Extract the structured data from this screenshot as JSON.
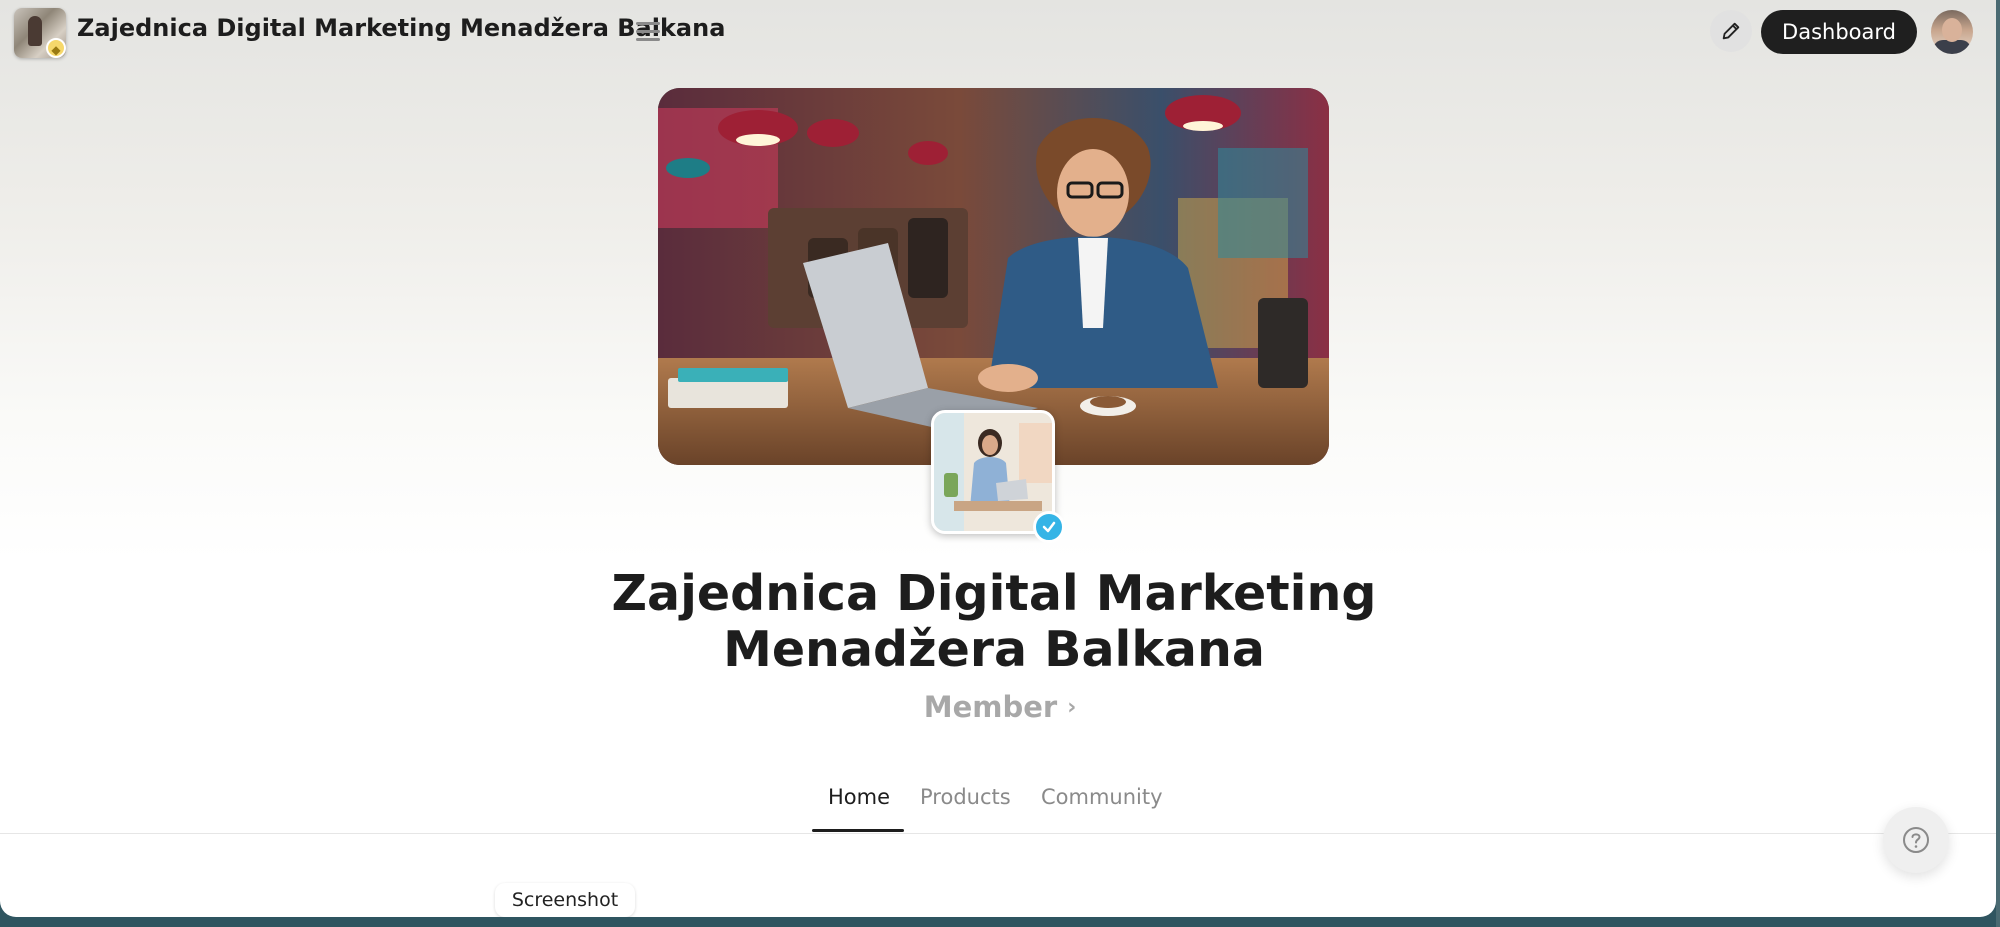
{
  "header": {
    "site_title": "Zajednica Digital Marketing Menadžera Balkana",
    "dashboard_label": "Dashboard",
    "logo_icon": "community-logo",
    "menu_icon": "hamburger-icon",
    "edit_icon": "pencil-icon",
    "avatar_icon": "user-avatar"
  },
  "hero": {
    "cover_image": "cover-photo-man-laptop-cafe",
    "profile_image": "community-photo-woman-laptop",
    "verified_icon": "check-icon",
    "title": "Zajednica Digital Marketing Menadžera Balkana",
    "membership_label": "Member",
    "membership_chevron": "›"
  },
  "tabs": [
    {
      "label": "Home",
      "active": true
    },
    {
      "label": "Products",
      "active": false
    },
    {
      "label": "Community",
      "active": false
    }
  ],
  "help": {
    "icon": "question-icon"
  },
  "tooltip": {
    "label": "Screenshot"
  },
  "colors": {
    "accent": "#1f1f1f",
    "verified": "#35b4e6",
    "muted_text": "#a8a8a8"
  }
}
